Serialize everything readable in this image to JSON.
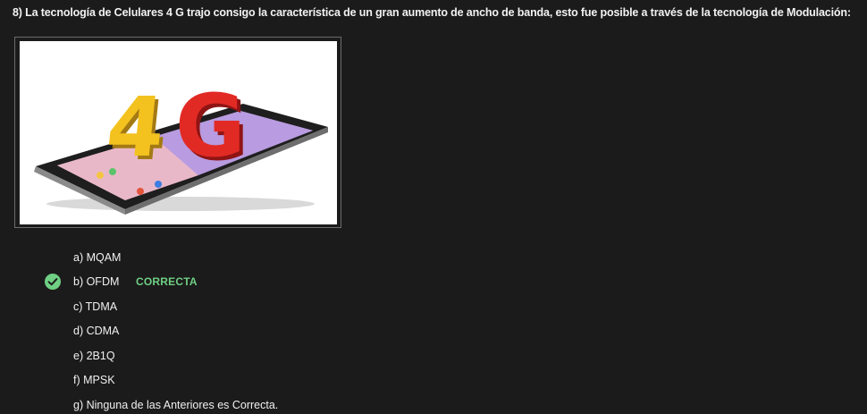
{
  "question": {
    "text": "8) La tecnología de Celulares 4 G trajo consigo la característica de un gran aumento de ancho de banda, esto fue posible a través de la tecnología de Modulación:"
  },
  "image": {
    "overlay_text": "4G"
  },
  "options": [
    {
      "label": "a) MQAM"
    },
    {
      "label": "b) OFDM"
    },
    {
      "label": "c) TDMA"
    },
    {
      "label": "d) CDMA"
    },
    {
      "label": "e) 2B1Q"
    },
    {
      "label": "f) MPSK"
    },
    {
      "label": "g) Ninguna de las Anteriores es Correcta."
    }
  ],
  "feedback": {
    "correct_label": "CORRECTA",
    "correct_icon": "check-circle-icon",
    "correct_color": "#6fcf83"
  }
}
